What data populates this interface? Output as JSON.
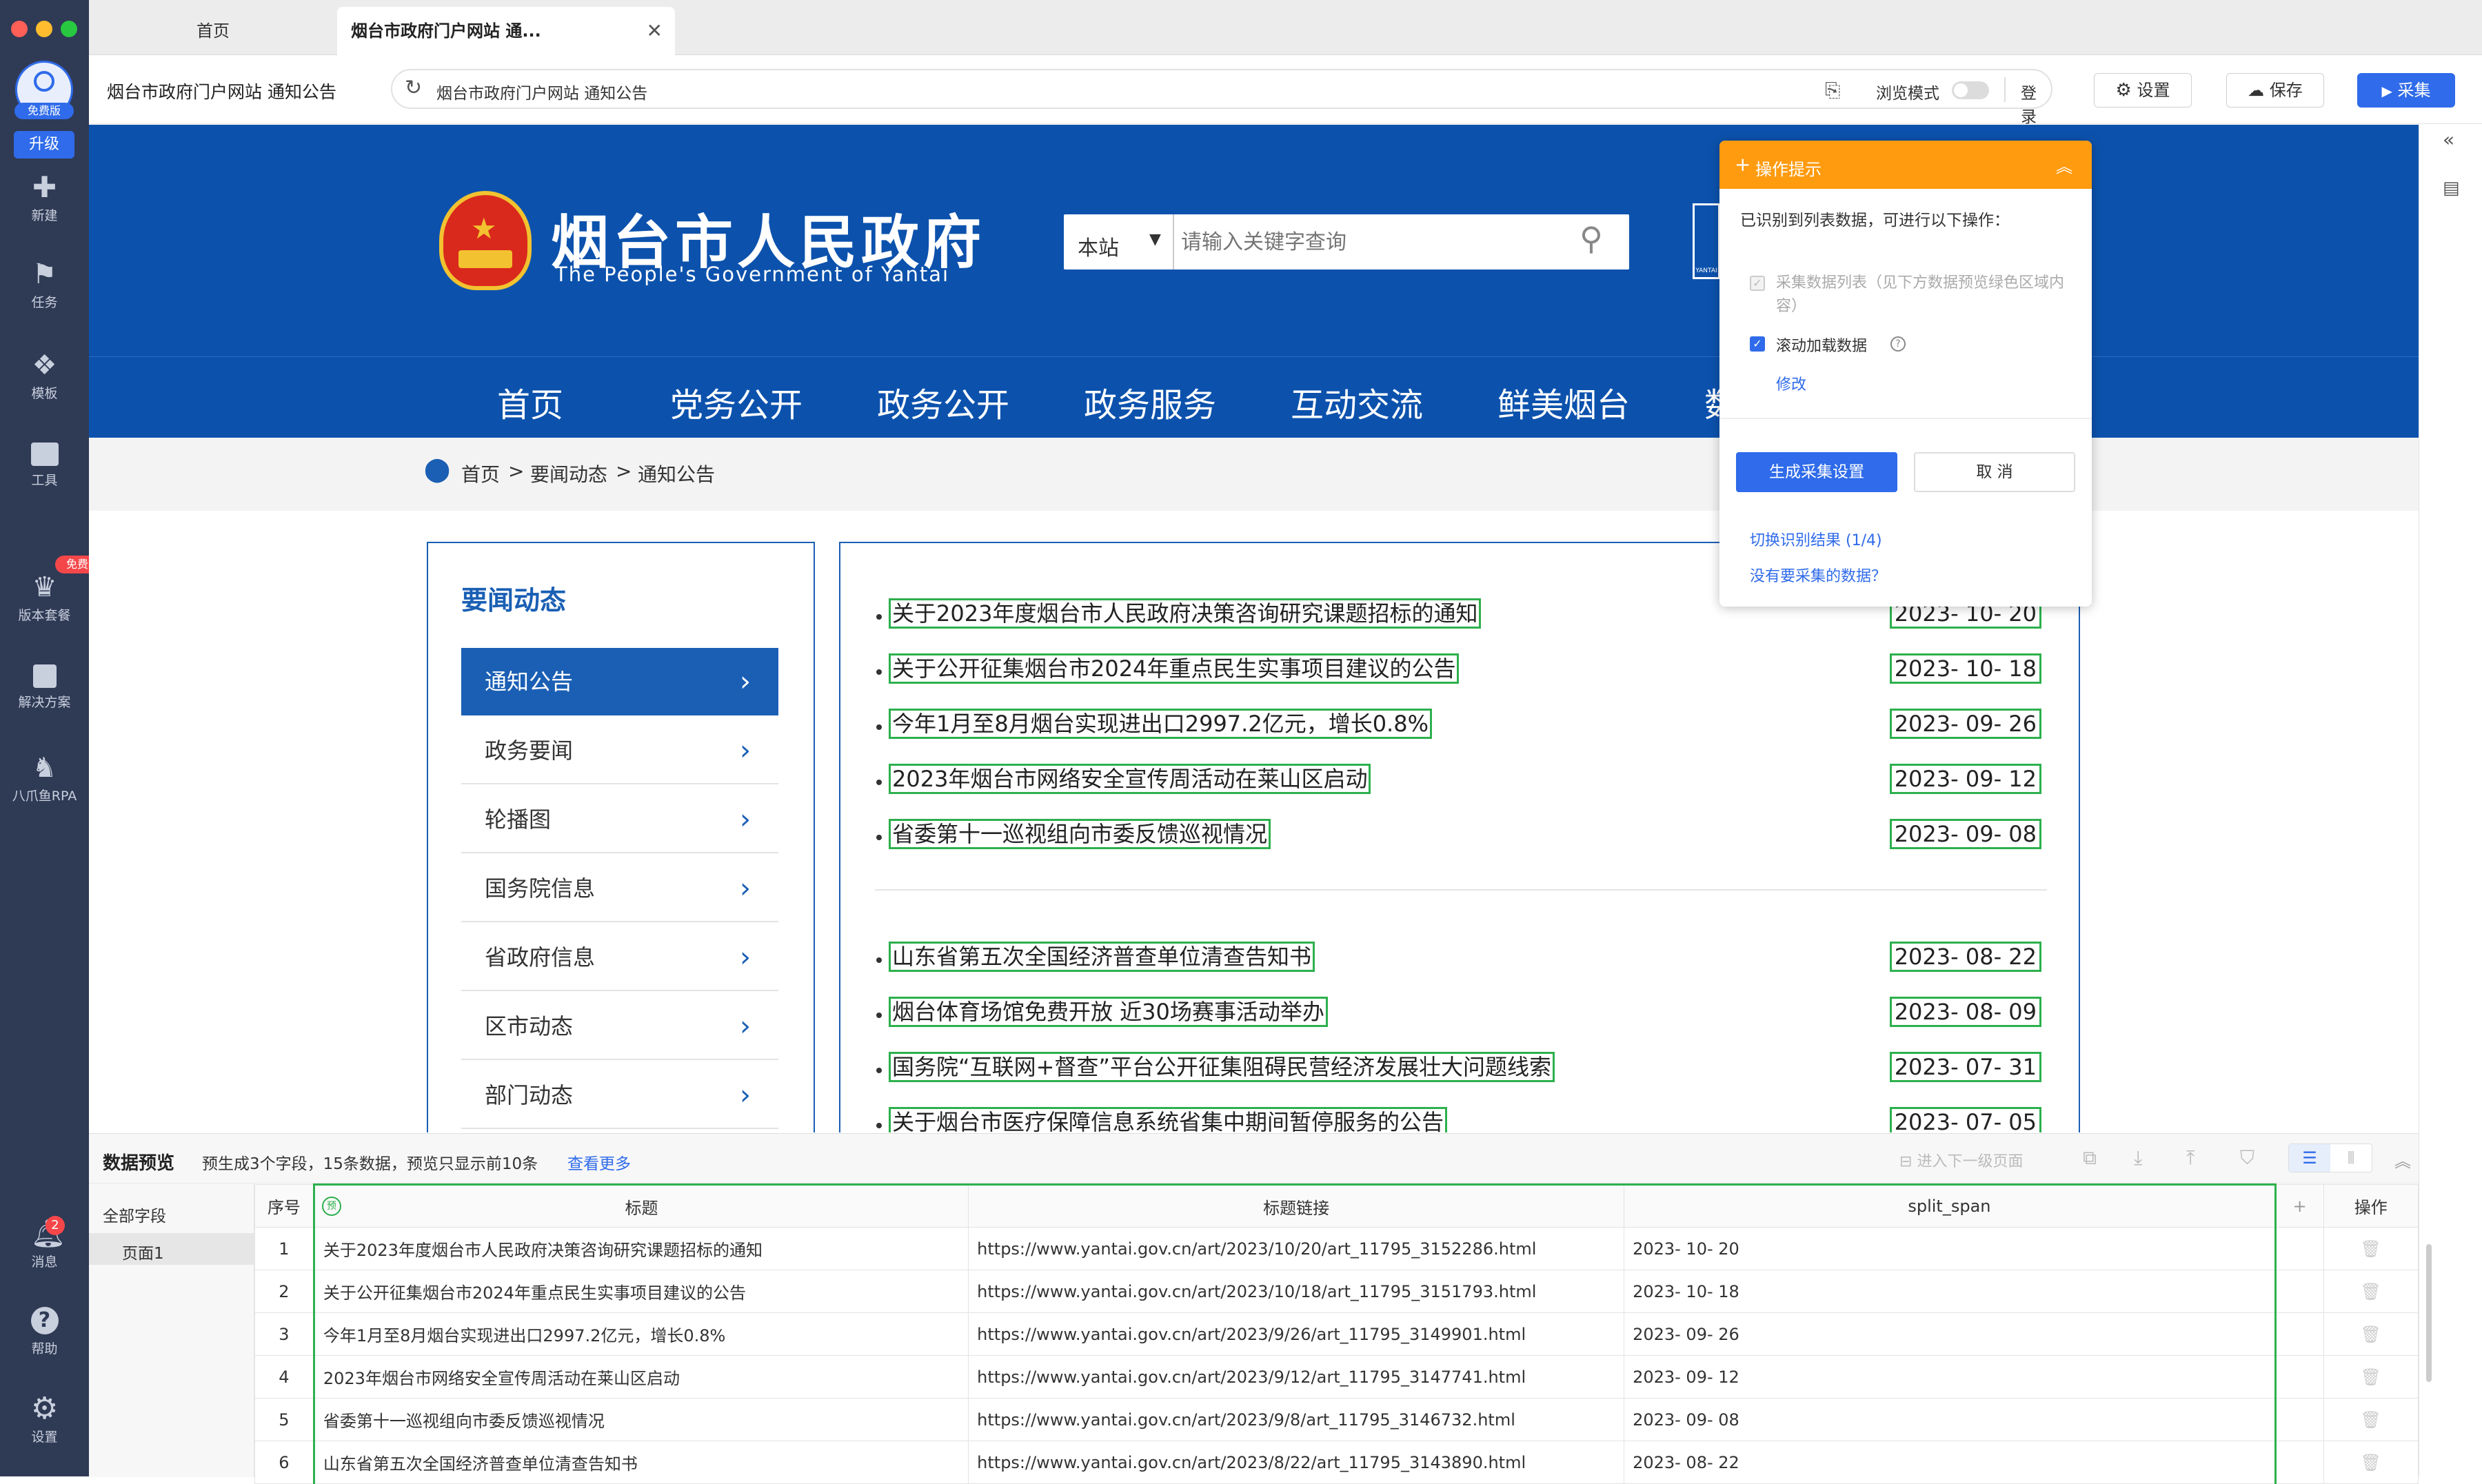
{
  "sidebar": {
    "avatar_badge": "免费版",
    "upgrade": "升级",
    "items": [
      {
        "label": "新建",
        "icon": "plus-icon"
      },
      {
        "label": "任务",
        "icon": "task-icon"
      },
      {
        "label": "模板",
        "icon": "template-icon"
      },
      {
        "label": "工具",
        "icon": "toolbox-icon"
      },
      {
        "label": "版本套餐",
        "icon": "crown-icon",
        "badge": "免费试用"
      },
      {
        "label": "解决方案",
        "icon": "solution-icon"
      },
      {
        "label": "八爪鱼RPA",
        "icon": "rpa-icon"
      },
      {
        "label": "消息",
        "icon": "bell-icon",
        "badge": "2"
      },
      {
        "label": "帮助",
        "icon": "help-icon"
      },
      {
        "label": "设置",
        "icon": "gear-icon"
      }
    ]
  },
  "tabs": [
    {
      "label": "首页"
    },
    {
      "label": "烟台市政府门户网站 通..."
    }
  ],
  "toolbar": {
    "page_title": "烟台市政府门户网站 通知公告",
    "url": "烟台市政府门户网站 通知公告",
    "browse_mode": "浏览模式",
    "login_site": "登录网站",
    "settings": "设置",
    "save": "保存",
    "collect": "采集"
  },
  "site": {
    "title": "烟台市人民政府",
    "subtitle": "The People's Government of Yantai",
    "search_scope": "本站",
    "search_placeholder": "请输入关键字查询",
    "side_logo_text": "YANTAI",
    "nav": [
      "首页",
      "党务公开",
      "政务公开",
      "政务服务",
      "互动交流",
      "鲜美烟台",
      "数"
    ],
    "breadcrumb": [
      "首页",
      ">",
      "要闻动态",
      ">",
      "通知公告"
    ],
    "leftnav_title": "要闻动态",
    "leftnav": [
      "通知公告",
      "政务要闻",
      "轮播图",
      "国务院信息",
      "省政府信息",
      "区市动态",
      "部门动态"
    ],
    "news_group1": [
      {
        "title": "关于2023年度烟台市人民政府决策咨询研究课题招标的通知",
        "date": "2023- 10- 20"
      },
      {
        "title": "关于公开征集烟台市2024年重点民生实事项目建议的公告",
        "date": "2023- 10- 18"
      },
      {
        "title": "今年1月至8月烟台实现进出口2997.2亿元，增长0.8%",
        "date": "2023- 09- 26"
      },
      {
        "title": "2023年烟台市网络安全宣传周活动在莱山区启动",
        "date": "2023- 09- 12"
      },
      {
        "title": "省委第十一巡视组向市委反馈巡视情况",
        "date": "2023- 09- 08"
      }
    ],
    "news_group2": [
      {
        "title": "山东省第五次全国经济普查单位清查告知书",
        "date": "2023- 08- 22"
      },
      {
        "title": "烟台体育场馆免费开放 近30场赛事活动举办",
        "date": "2023- 08- 09"
      },
      {
        "title": "国务院“互联网+督查”平台公开征集阻碍民营经济发展壮大问题线索",
        "date": "2023- 07- 31"
      },
      {
        "title": "关于烟台市医疗保障信息系统省集中期间暂停服务的公告",
        "date": "2023- 07- 05"
      }
    ]
  },
  "popup": {
    "title": "操作提示",
    "desc": "已识别到列表数据，可进行以下操作：",
    "opt1": "采集数据列表（见下方数据预览绿色区域内容）",
    "opt2": "滚动加载数据",
    "modify": "修改",
    "generate": "生成采集设置",
    "cancel": "取 消",
    "switch": "切换识别结果 (1/4)",
    "no_data": "没有要采集的数据？"
  },
  "preview": {
    "title": "数据预览",
    "summary": "预生成3个字段，15条数据，预览只显示前10条",
    "more": "查看更多",
    "next_level": "进入下一级页面",
    "all_fields": "全部字段",
    "page": "页面1",
    "headers": [
      "序号",
      "标题",
      "标题链接",
      "split_span",
      "+",
      "操作"
    ],
    "pre_badge": "预",
    "rows": [
      [
        "1",
        "关于2023年度烟台市人民政府决策咨询研究课题招标的通知",
        "https://www.yantai.gov.cn/art/2023/10/20/art_11795_3152286.html",
        "2023- 10- 20"
      ],
      [
        "2",
        "关于公开征集烟台市2024年重点民生实事项目建议的公告",
        "https://www.yantai.gov.cn/art/2023/10/18/art_11795_3151793.html",
        "2023- 10- 18"
      ],
      [
        "3",
        "今年1月至8月烟台实现进出口2997.2亿元，增长0.8%",
        "https://www.yantai.gov.cn/art/2023/9/26/art_11795_3149901.html",
        "2023- 09- 26"
      ],
      [
        "4",
        "2023年烟台市网络安全宣传周活动在莱山区启动",
        "https://www.yantai.gov.cn/art/2023/9/12/art_11795_3147741.html",
        "2023- 09- 12"
      ],
      [
        "5",
        "省委第十一巡视组向市委反馈巡视情况",
        "https://www.yantai.gov.cn/art/2023/9/8/art_11795_3146732.html",
        "2023- 09- 08"
      ],
      [
        "6",
        "山东省第五次全国经济普查单位清查告知书",
        "https://www.yantai.gov.cn/art/2023/8/22/art_11795_3143890.html",
        "2023- 08- 22"
      ]
    ]
  }
}
